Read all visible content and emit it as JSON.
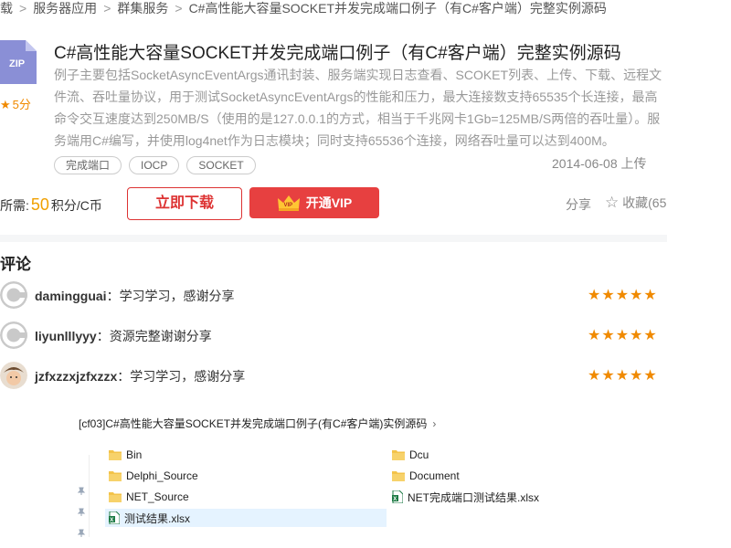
{
  "breadcrumb": {
    "items": [
      "载",
      "服务器应用",
      "群集服务",
      "C#高性能大容量SOCKET并发完成端口例子（有C#客户端）完整实例源码"
    ],
    "sep": ">"
  },
  "resource": {
    "icon_label": "ZIP",
    "rating": "5分",
    "title": "C#高性能大容量SOCKET并发完成端口例子（有C#客户端）完整实例源码",
    "description": "例子主要包括SocketAsyncEventArgs通讯封装、服务端实现日志查看、SCOKET列表、上传、下载、远程文件流、吞吐量协议，用于测试SocketAsyncEventArgs的性能和压力，最大连接数支持65535个长连接，最高命令交互速度达到250MB/S（使用的是127.0.0.1的方式，相当于千兆网卡1Gb=125MB/S两倍的吞吐量）。服务端用C#编写，并使用log4net作为日志模块；同时支持65536个连接，网络吞吐量可以达到400M。",
    "tags": [
      "完成端口",
      "IOCP",
      "SOCKET"
    ],
    "upload_date": "2014-06-08 上传",
    "need_label": "所需:",
    "points": "50",
    "points_unit": "积分/C币",
    "download_label": "立即下载",
    "vip_label": "开通VIP",
    "share_label": "分享",
    "collect_label": "收藏(65"
  },
  "comments": {
    "title": "评论",
    "items": [
      {
        "user": "damingguai",
        "text": "学习学习，感谢分享",
        "stars": "★★★★★"
      },
      {
        "user": "liyunlllyyy",
        "text": "资源完整谢谢分享",
        "stars": "★★★★★"
      },
      {
        "user": "jzfxzzxjzfxzzx",
        "text": "学习学习，感谢分享",
        "stars": "★★★★★"
      }
    ]
  },
  "explorer": {
    "path": "[cf03]C#高性能大容量SOCKET并发完成端口例子(有C#客户端)实例源码",
    "left_files": [
      {
        "name": "Bin",
        "type": "folder"
      },
      {
        "name": "Delphi_Source",
        "type": "folder"
      },
      {
        "name": "NET_Source",
        "type": "folder"
      },
      {
        "name": "测试结果.xlsx",
        "type": "excel"
      }
    ],
    "right_files": [
      {
        "name": "Dcu",
        "type": "folder"
      },
      {
        "name": "Document",
        "type": "folder"
      },
      {
        "name": "NET完成端口测试结果.xlsx",
        "type": "excel"
      }
    ]
  },
  "colors": {
    "accent_red": "#e74040",
    "star_orange": "#f08a00",
    "points_gold": "#f0a000",
    "folder_yellow": "#f3c34a",
    "excel_green": "#1e7b45"
  }
}
